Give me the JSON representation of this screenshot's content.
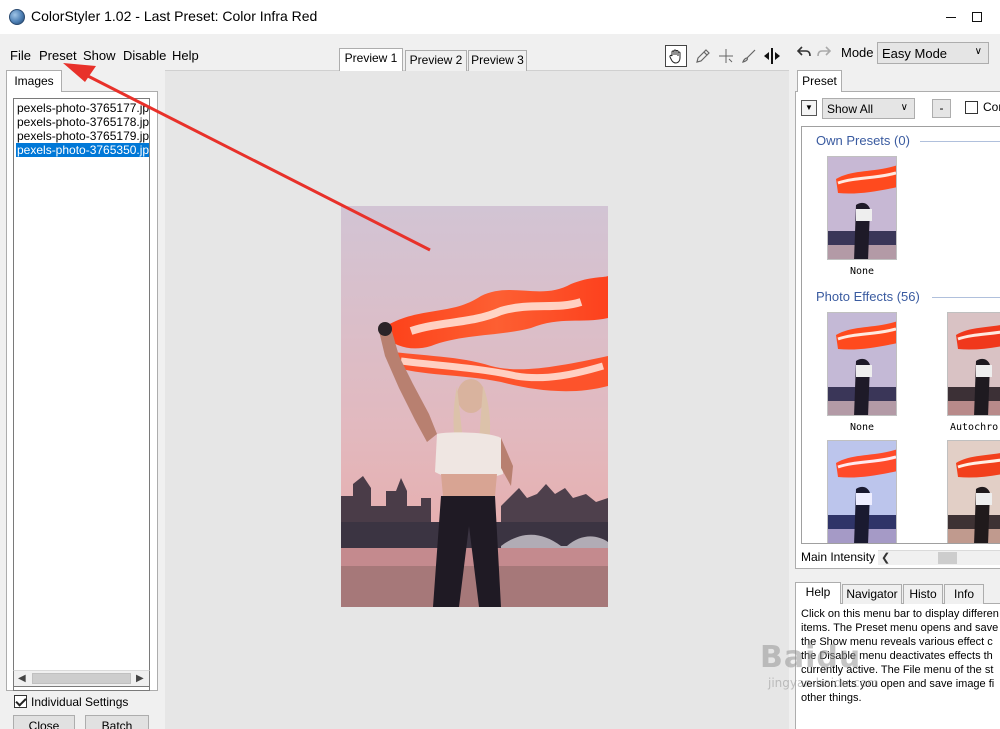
{
  "window": {
    "title": "ColorStyler 1.02 - Last Preset: Color Infra Red",
    "minimize_label": "",
    "maximize_label": ""
  },
  "menu": [
    "File",
    "Preset",
    "Show",
    "Disable",
    "Help"
  ],
  "left_panel": {
    "tab": "Images",
    "files": [
      {
        "name": "pexels-photo-3765177.jpg",
        "selected": false
      },
      {
        "name": "pexels-photo-3765178.jpg",
        "selected": false
      },
      {
        "name": "pexels-photo-3765179.jpg",
        "selected": false
      },
      {
        "name": "pexels-photo-3765350.jpg",
        "selected": true
      }
    ],
    "individual_settings_label": "Individual Settings",
    "individual_settings_checked": true,
    "close_label": "Close",
    "batch_label": "Batch"
  },
  "preview_tabs": [
    {
      "label": "Preview 1",
      "active": true
    },
    {
      "label": "Preview 2",
      "active": false
    },
    {
      "label": "Preview 3",
      "active": false
    }
  ],
  "tools": [
    "hand-icon",
    "eyedropper-icon",
    "crosshair-icon",
    "brush-icon",
    "split-icon"
  ],
  "mode": {
    "label": "Mode",
    "value": "Easy Mode",
    "undo_icon": "undo-icon",
    "redo_icon": "redo-icon"
  },
  "preset_panel": {
    "tab": "Preset",
    "filter_value": "Show All",
    "minus_label": "-",
    "con_label": "Con",
    "groups": [
      {
        "title": "Own Presets (0)",
        "items": [
          {
            "label": "None"
          }
        ]
      },
      {
        "title": "Photo Effects (56)",
        "items": [
          {
            "label": "None"
          },
          {
            "label": "Autochro"
          },
          {
            "label": ""
          },
          {
            "label": ""
          }
        ]
      }
    ],
    "main_intensity_label": "Main Intensity"
  },
  "bottom_tabs": [
    {
      "label": "Help",
      "active": true
    },
    {
      "label": "Navigator",
      "active": false
    },
    {
      "label": "Histo",
      "active": false
    },
    {
      "label": "Info",
      "active": false
    }
  ],
  "help_text": "Click on this menu bar to display differen\nitems. The Preset menu opens and save\nthe Show menu reveals various effect c\nthe Disable menu deactivates effects th\ncurrently active. The File menu of the st\nversion lets you open and save image fi\nother things.",
  "watermark": {
    "text": "Baidu",
    "sub": "jingyan.baidu.com"
  },
  "colors": {
    "selection": "#0078d7",
    "group_title": "#3a5ba0",
    "annotation_arrow": "#e8312a"
  }
}
